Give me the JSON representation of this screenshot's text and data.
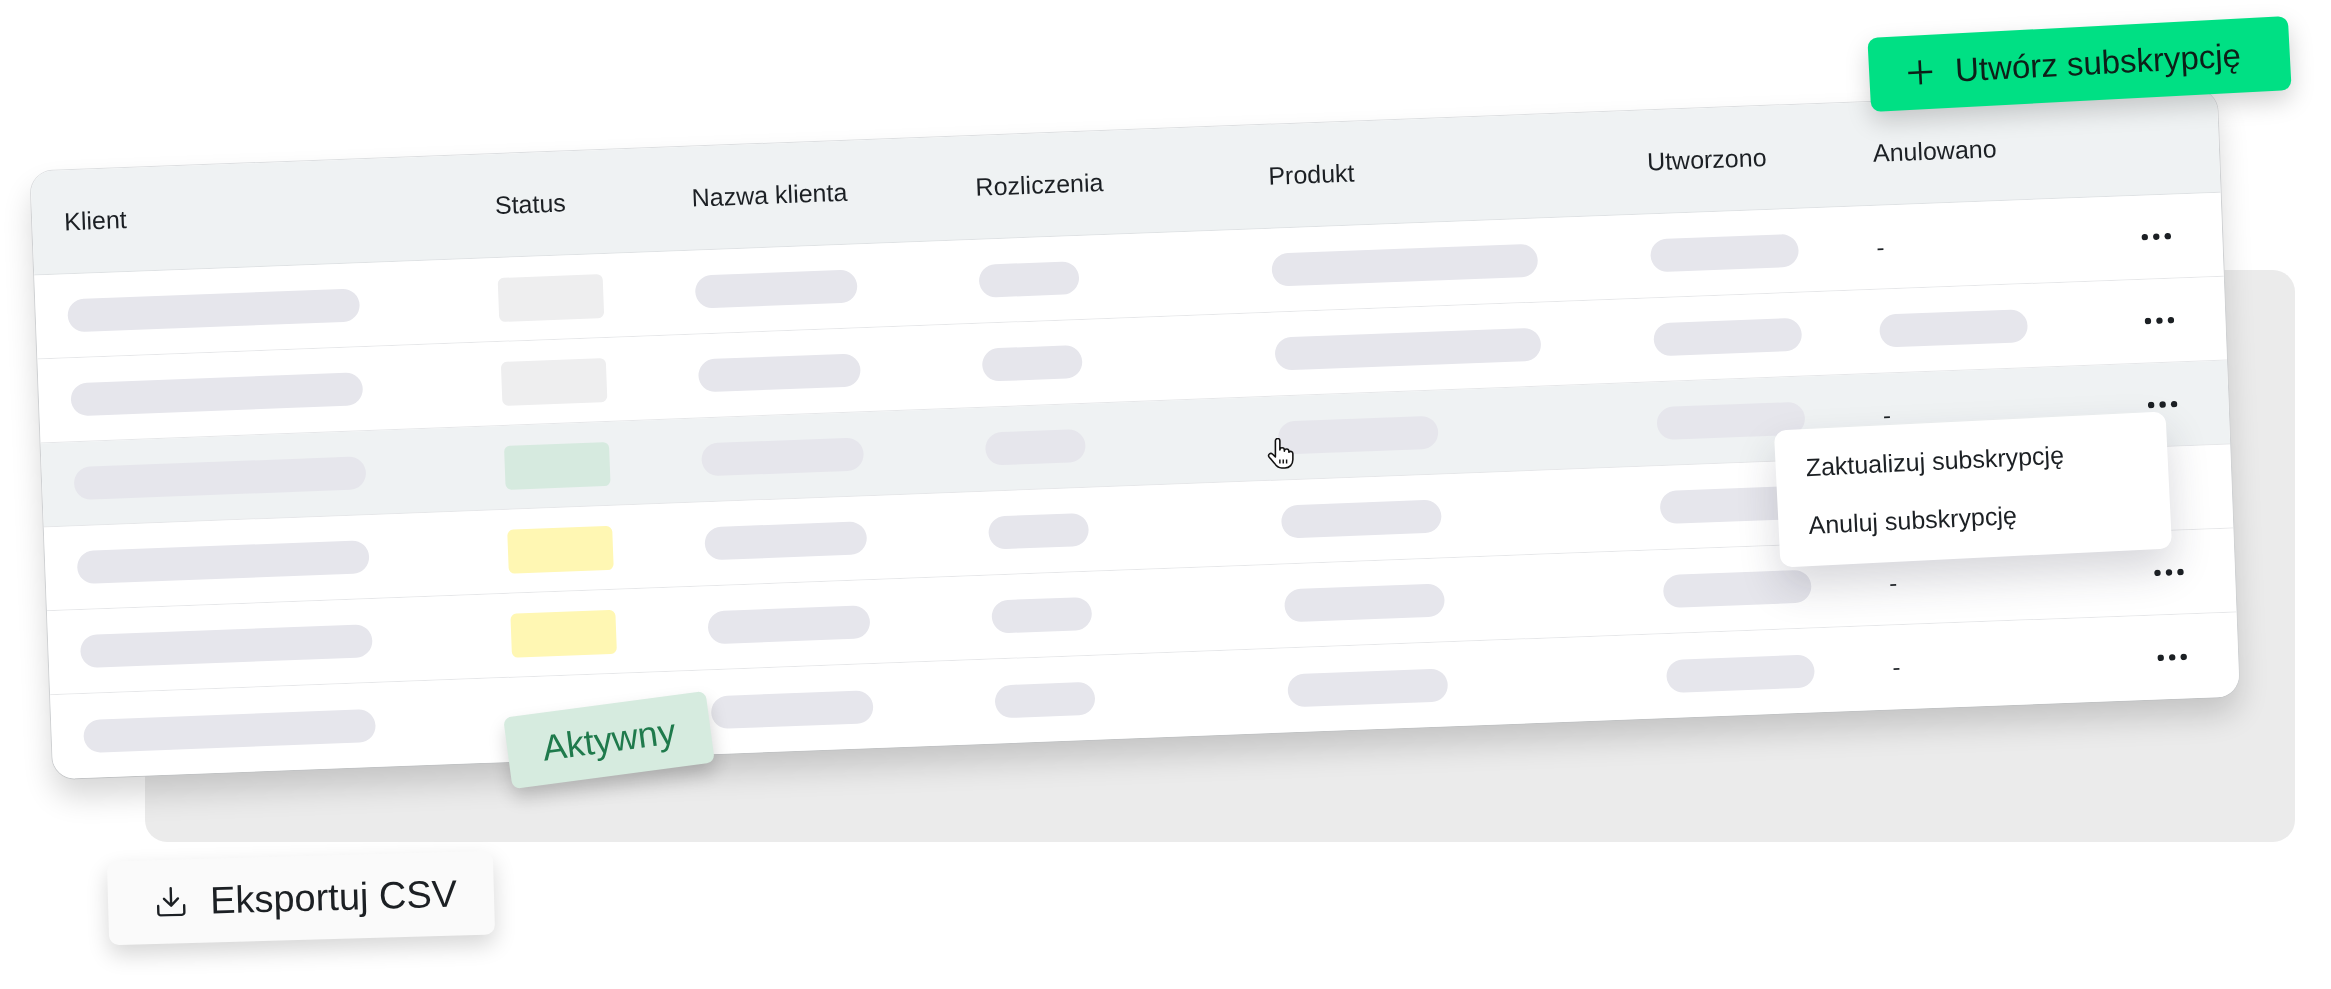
{
  "create_button": {
    "label": "Utwórz subskrypcję"
  },
  "table": {
    "columns": [
      "Klient",
      "Status",
      "Nazwa klienta",
      "Rozliczenia",
      "Produkt",
      "Utworzono",
      "Anulowano"
    ],
    "rows": [
      {
        "highlighted": false,
        "status": {
          "color": "#eeeeef"
        },
        "product": {
          "kind": "wide"
        },
        "cancelled": {
          "kind": "text",
          "text": "-"
        },
        "more_button": true
      },
      {
        "highlighted": false,
        "status": {
          "color": "#eeeeef"
        },
        "product": {
          "kind": "wide"
        },
        "cancelled": {
          "kind": "placeholder"
        },
        "more_button": true
      },
      {
        "highlighted": true,
        "status": {
          "color": "#d6eadf"
        },
        "product": {
          "kind": "narrow"
        },
        "cancelled": {
          "kind": "text",
          "text": "-"
        },
        "more_button": true
      },
      {
        "highlighted": false,
        "status": {
          "color": "#fff7b3"
        },
        "product": {
          "kind": "narrow"
        },
        "more_button": false
      },
      {
        "highlighted": false,
        "status": {
          "color": "#fff7b3"
        },
        "product": {
          "kind": "narrow"
        },
        "cancelled": {
          "kind": "text",
          "text": "-"
        },
        "more_button": true
      },
      {
        "highlighted": false,
        "product": {
          "kind": "narrow"
        },
        "cancelled": {
          "kind": "text",
          "text": "-"
        },
        "more_button": true
      }
    ]
  },
  "row_menu": {
    "items": [
      "Zaktualizuj subskrypcję",
      "Anuluj subskrypcję"
    ]
  },
  "status_badge": {
    "label": "Aktywny"
  },
  "export_button": {
    "label": "Eksportuj CSV"
  }
}
